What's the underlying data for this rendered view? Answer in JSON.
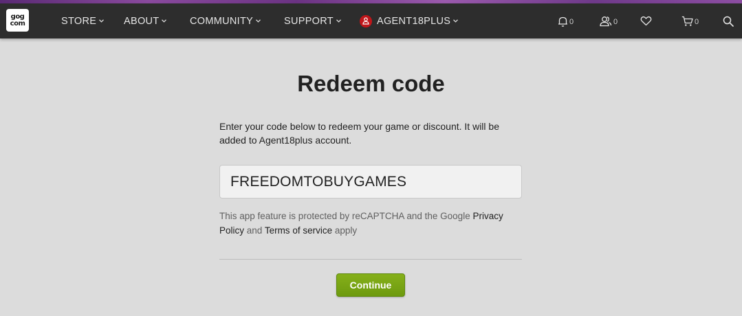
{
  "nav": {
    "logo_top": "gog",
    "logo_bottom": "com",
    "items": [
      {
        "label": "STORE"
      },
      {
        "label": "ABOUT"
      },
      {
        "label": "COMMUNITY"
      },
      {
        "label": "SUPPORT"
      }
    ],
    "user": {
      "label": "AGENT18PLUS"
    },
    "icons": {
      "notifications_count": "0",
      "friends_count": "0",
      "cart_count": "0"
    }
  },
  "page": {
    "title": "Redeem code",
    "description": "Enter your code below to redeem your game or discount. It will be added to Agent18plus account.",
    "code_value": "FREEDOMTOBUYGAMES",
    "recaptcha": {
      "prefix": "This app feature is protected by reCAPTCHA and the Google ",
      "privacy_link": "Privacy Policy",
      "and": " and ",
      "terms_link": "Terms of service",
      "suffix": " apply"
    },
    "continue_label": "Continue"
  },
  "colors": {
    "navbar": "#2d2d2d",
    "background": "#dcdcdc",
    "accent_green": "#7aa616",
    "user_badge": "#c0161a"
  }
}
